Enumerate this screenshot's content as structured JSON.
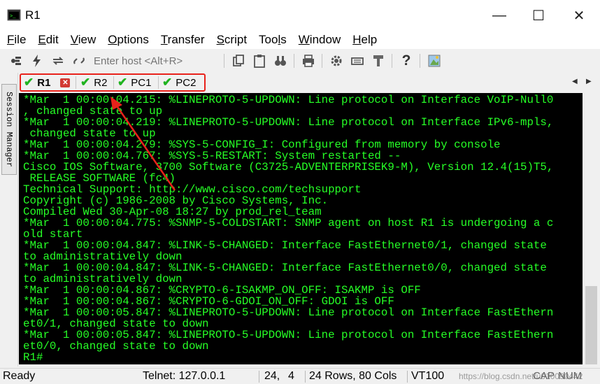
{
  "window": {
    "title": "R1"
  },
  "menu": [
    "File",
    "Edit",
    "View",
    "Options",
    "Transfer",
    "Script",
    "Tools",
    "Window",
    "Help"
  ],
  "menu_mnemonic": [
    "F",
    "E",
    "V",
    "O",
    "T",
    "S",
    "l",
    "W",
    "H"
  ],
  "toolbar": {
    "host_placeholder": "Enter host <Alt+R>"
  },
  "session_manager": {
    "label": "Session Manager"
  },
  "tabs": [
    {
      "label": "R1"
    },
    {
      "label": "R2"
    },
    {
      "label": "PC1"
    },
    {
      "label": "PC2"
    }
  ],
  "terminal": {
    "lines": [
      "*Mar  1 00:00:04.215: %LINEPROTO-5-UPDOWN: Line protocol on Interface VoIP-Null0",
      ", changed state to up",
      "*Mar  1 00:00:04.219: %LINEPROTO-5-UPDOWN: Line protocol on Interface IPv6-mpls,",
      " changed state to up",
      "*Mar  1 00:00:04.279: %SYS-5-CONFIG_I: Configured from memory by console",
      "*Mar  1 00:00:04.767: %SYS-5-RESTART: System restarted --",
      "Cisco IOS Software, 3700 Software (C3725-ADVENTERPRISEK9-M), Version 12.4(15)T5,",
      " RELEASE SOFTWARE (fc4)",
      "Technical Support: http://www.cisco.com/techsupport",
      "Copyright (c) 1986-2008 by Cisco Systems, Inc.",
      "Compiled Wed 30-Apr-08 18:27 by prod_rel_team",
      "*Mar  1 00:00:04.775: %SNMP-5-COLDSTART: SNMP agent on host R1 is undergoing a c",
      "old start",
      "*Mar  1 00:00:04.847: %LINK-5-CHANGED: Interface FastEthernet0/1, changed state",
      "to administratively down",
      "*Mar  1 00:00:04.847: %LINK-5-CHANGED: Interface FastEthernet0/0, changed state",
      "to administratively down",
      "*Mar  1 00:00:04.867: %CRYPTO-6-ISAKMP_ON_OFF: ISAKMP is OFF",
      "*Mar  1 00:00:04.867: %CRYPTO-6-GDOI_ON_OFF: GDOI is OFF",
      "*Mar  1 00:00:05.847: %LINEPROTO-5-UPDOWN: Line protocol on Interface FastEthern",
      "et0/1, changed state to down",
      "*Mar  1 00:00:05.847: %LINEPROTO-5-UPDOWN: Line protocol on Interface FastEthern",
      "et0/0, changed state to down",
      "R1#"
    ]
  },
  "status": {
    "ready": "Ready",
    "connection": "Telnet: 127.0.0.1",
    "cursor_row": "24,",
    "cursor_col": "4",
    "size": "24 Rows, 80 Cols",
    "emulation": "VT100",
    "caps": "CAP",
    "num": "NUM",
    "watermark": "https://blog.csdn.net/u010090442"
  },
  "colors": {
    "terminal_bg": "#000000",
    "terminal_fg": "#26ff26",
    "annotation": "#e8221b",
    "check": "#1fb31f"
  },
  "icons": [
    "app-icon",
    "minimize-icon",
    "maximize-icon",
    "close-icon",
    "connect-icon",
    "quick-connect-icon",
    "reconnect-icon",
    "disconnect-icon",
    "copy-icon",
    "paste-icon",
    "find-icon",
    "print-icon",
    "settings-icon",
    "keymap-icon",
    "sftp-icon",
    "help-icon",
    "map-icon"
  ]
}
